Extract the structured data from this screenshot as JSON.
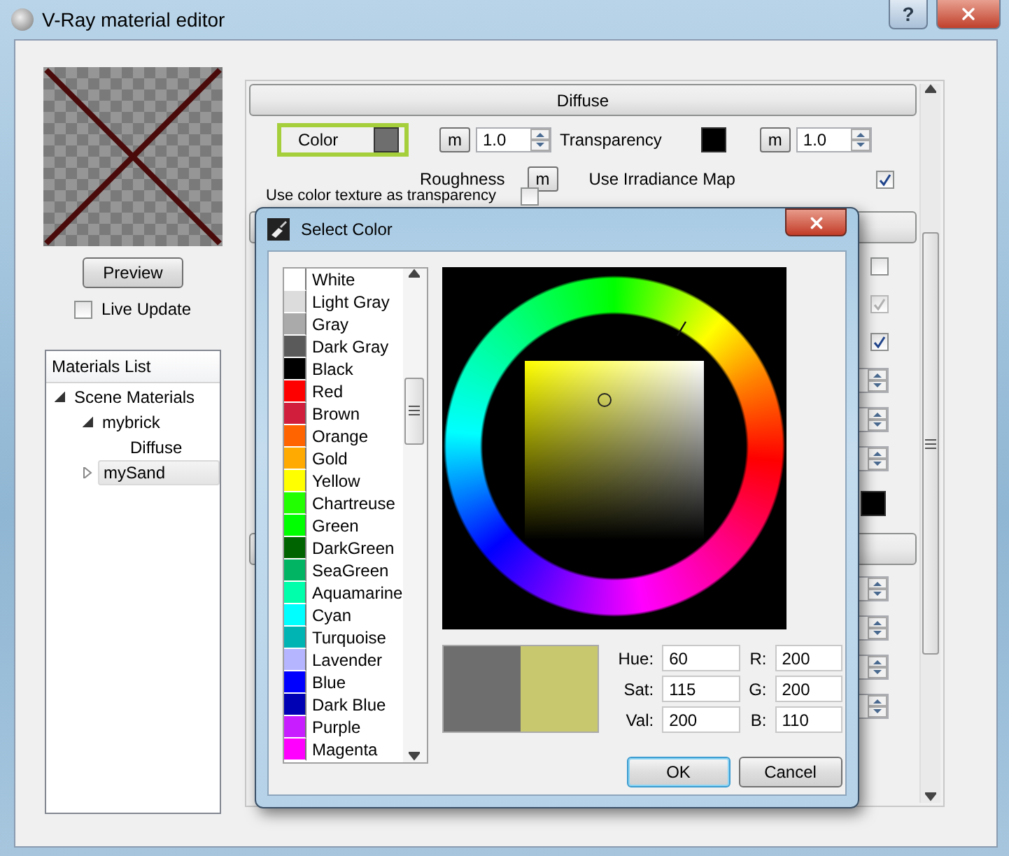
{
  "window": {
    "title": "V-Ray material editor",
    "help": "?"
  },
  "preview": {
    "button": "Preview",
    "live_update": {
      "label": "Live Update",
      "checked": false
    }
  },
  "materials_list": {
    "title": "Materials List",
    "items": [
      {
        "label": "Scene Materials",
        "expanded": true,
        "selected": false,
        "children": [
          {
            "label": "mybrick",
            "expanded": true,
            "selected": false,
            "children": [
              {
                "label": "Diffuse",
                "selected": false
              }
            ]
          },
          {
            "label": "mySand",
            "expanded": false,
            "selected": true
          }
        ]
      }
    ]
  },
  "diffuse": {
    "header": "Diffuse",
    "color": {
      "label": "Color",
      "color": "#6e6e6e",
      "highlighted": true,
      "map": "m",
      "amount": "1.0"
    },
    "transparency": {
      "label": "Transparency",
      "color": "#000000",
      "map": "m",
      "amount": "1.0"
    },
    "roughness": {
      "label": "Roughness",
      "map": "m"
    },
    "irradiance": {
      "label": "Use Irradiance Map",
      "checked": true
    },
    "texture_transparency": {
      "label": "Use color texture as transparency",
      "checked": false
    }
  },
  "hidden_controls": [
    {
      "kind": "header"
    },
    {
      "kind": "checkbox",
      "checked": false,
      "disabled": false
    },
    {
      "kind": "checkbox",
      "checked": true,
      "disabled": true
    },
    {
      "kind": "checkbox",
      "checked": true,
      "disabled": false
    },
    {
      "kind": "spinner"
    },
    {
      "kind": "spinner"
    },
    {
      "kind": "spinner"
    },
    {
      "kind": "swatch",
      "color": "#000000"
    },
    {
      "kind": "header"
    },
    {
      "kind": "spinner"
    },
    {
      "kind": "spinner"
    },
    {
      "kind": "spinner"
    },
    {
      "kind": "spinner"
    }
  ],
  "dialog": {
    "title": "Select Color",
    "colors": [
      {
        "name": "White",
        "color": "#ffffff"
      },
      {
        "name": "Light Gray",
        "color": "#dcdcdc"
      },
      {
        "name": "Gray",
        "color": "#aaaaaa"
      },
      {
        "name": "Dark Gray",
        "color": "#5a5a5a"
      },
      {
        "name": "Black",
        "color": "#000000"
      },
      {
        "name": "Red",
        "color": "#ff0000"
      },
      {
        "name": "Brown",
        "color": "#d01e3c"
      },
      {
        "name": "Orange",
        "color": "#ff6400"
      },
      {
        "name": "Gold",
        "color": "#ffaa00"
      },
      {
        "name": "Yellow",
        "color": "#ffff00"
      },
      {
        "name": "Chartreuse",
        "color": "#22ff00"
      },
      {
        "name": "Green",
        "color": "#00ff00"
      },
      {
        "name": "DarkGreen",
        "color": "#006400"
      },
      {
        "name": "SeaGreen",
        "color": "#00b464"
      },
      {
        "name": "Aquamarine",
        "color": "#00ffaa"
      },
      {
        "name": "Cyan",
        "color": "#00ffff"
      },
      {
        "name": "Turquoise",
        "color": "#00b4b4"
      },
      {
        "name": "Lavender",
        "color": "#b4b4ff"
      },
      {
        "name": "Blue",
        "color": "#0000ff"
      },
      {
        "name": "Dark Blue",
        "color": "#0000b4"
      },
      {
        "name": "Purple",
        "color": "#c81eff"
      },
      {
        "name": "Magenta",
        "color": "#ff00ff"
      }
    ],
    "old_swatch": {
      "color": "#6e6e6e"
    },
    "fields": [
      {
        "label": "Hue:",
        "value": "60"
      },
      {
        "label": "R:",
        "value": "200"
      },
      {
        "label": "Sat:",
        "value": "115"
      },
      {
        "label": "G:",
        "value": "200"
      },
      {
        "label": "Val:",
        "value": "200"
      },
      {
        "label": "B:",
        "value": "110"
      }
    ],
    "buttons": [
      {
        "label": "OK",
        "default": true
      },
      {
        "label": "Cancel",
        "default": false
      }
    ]
  }
}
